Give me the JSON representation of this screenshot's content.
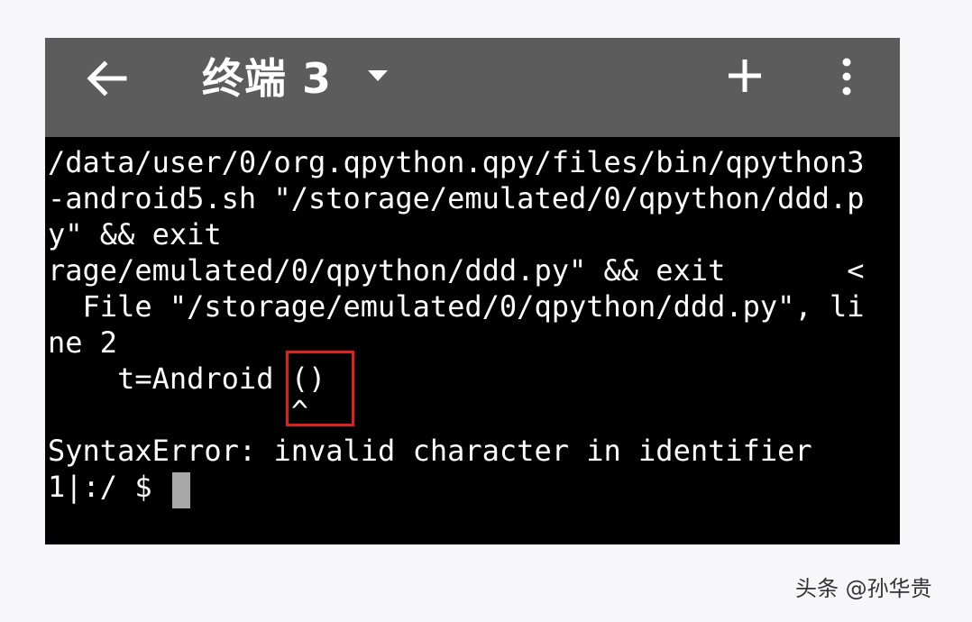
{
  "toolbar": {
    "title": "终端 3",
    "icons": [
      "back-arrow-icon",
      "dropdown-caret-icon",
      "plus-icon",
      "more-vert-icon"
    ],
    "background_color": "#5c5c5c"
  },
  "terminal": {
    "lines": [
      "/data/user/0/org.qpython.qpy/files/bin/qpython3",
      "-android5.sh \"/storage/emulated/0/qpython/ddd.p",
      "y\" && exit",
      "rage/emulated/0/qpython/ddd.py\" && exit       <",
      "  File \"/storage/emulated/0/qpython/ddd.py\", li",
      "ne 2",
      "    t=Android ()",
      "              ^",
      "SyntaxError: invalid character in identifier",
      "1|:/ $ "
    ],
    "background_color": "#000000",
    "text_color": "#ffffff",
    "highlight_color": "#e02020"
  },
  "watermark": "头条 @孙华贵"
}
